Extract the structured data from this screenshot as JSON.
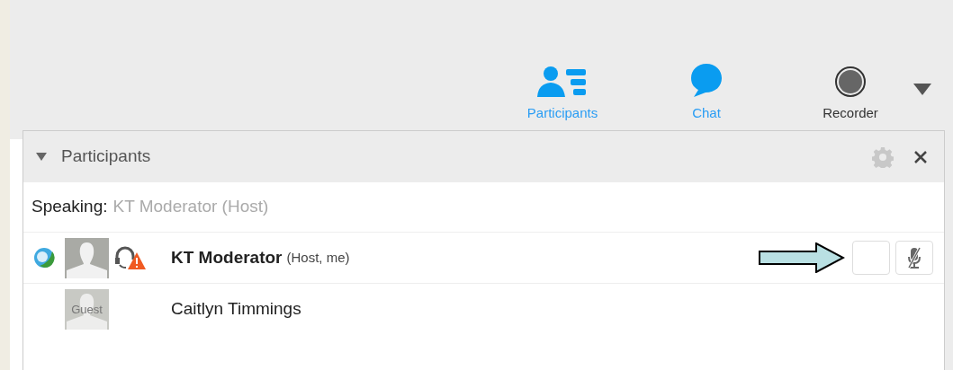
{
  "toolbar": [
    {
      "kind": "participants",
      "label": "Participants",
      "active": true
    },
    {
      "kind": "chat",
      "label": "Chat",
      "active": true
    },
    {
      "kind": "recorder",
      "label": "Recorder",
      "active": false
    }
  ],
  "panel": {
    "title": "Participants",
    "expanded": true
  },
  "speaking": {
    "label": "Speaking:",
    "name": "KT Moderator (Host)"
  },
  "participants": [
    {
      "name": "KT Moderator",
      "role": "(Host, me)",
      "bold": true,
      "kind": "host"
    },
    {
      "name": "Caitlyn Timmings",
      "bold": false,
      "kind": "guest",
      "avatar_label": "Guest"
    }
  ]
}
